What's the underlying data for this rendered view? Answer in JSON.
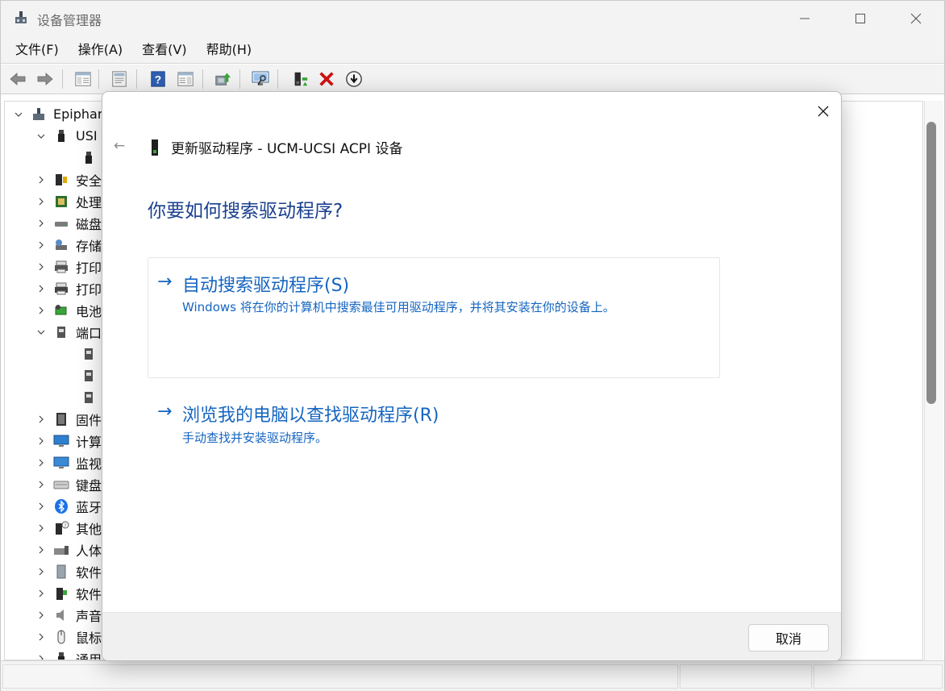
{
  "window": {
    "title": "设备管理器",
    "controls": {
      "minimize": "minimize-icon",
      "maximize": "maximize-icon",
      "close": "close-icon"
    }
  },
  "menu": [
    {
      "label": "文件(F)"
    },
    {
      "label": "操作(A)"
    },
    {
      "label": "查看(V)"
    },
    {
      "label": "帮助(H)"
    }
  ],
  "toolbar": [
    {
      "icon": "back-arrow-icon"
    },
    {
      "icon": "forward-arrow-icon"
    },
    {
      "icon": "show-hide-console-tree-icon"
    },
    {
      "icon": "properties-icon"
    },
    {
      "icon": "help-icon"
    },
    {
      "icon": "action-pane-icon"
    },
    {
      "icon": "update-driver-icon"
    },
    {
      "icon": "scan-hardware-icon"
    },
    {
      "icon": "enable-device-icon"
    },
    {
      "icon": "uninstall-device-icon"
    },
    {
      "icon": "disable-device-icon"
    }
  ],
  "tree": {
    "root": "Epiphar",
    "usb_group": "USI",
    "items": [
      {
        "label": "安全",
        "icon": "security-device-icon"
      },
      {
        "label": "处理",
        "icon": "processor-icon"
      },
      {
        "label": "磁盘",
        "icon": "disk-drive-icon"
      },
      {
        "label": "存储",
        "icon": "storage-controller-icon"
      },
      {
        "label": "打印",
        "icon": "print-queue-icon"
      },
      {
        "label": "打印",
        "icon": "printer-icon"
      },
      {
        "label": "电池",
        "icon": "battery-icon"
      },
      {
        "label": "端口",
        "icon": "port-icon"
      }
    ],
    "items2": [
      {
        "label": "固件",
        "icon": "firmware-icon"
      },
      {
        "label": "计算",
        "icon": "computer-icon"
      },
      {
        "label": "监视",
        "icon": "monitor-icon"
      },
      {
        "label": "键盘",
        "icon": "keyboard-icon"
      },
      {
        "label": "蓝牙",
        "icon": "bluetooth-icon"
      },
      {
        "label": "其他",
        "icon": "other-device-icon"
      },
      {
        "label": "人体",
        "icon": "hid-icon"
      },
      {
        "label": "软件",
        "icon": "software-component-icon"
      },
      {
        "label": "软件",
        "icon": "software-device-icon"
      },
      {
        "label": "声音",
        "icon": "sound-icon"
      },
      {
        "label": "鼠标",
        "icon": "mouse-icon"
      },
      {
        "label": "通用",
        "icon": "usb-controller-icon"
      }
    ]
  },
  "dialog": {
    "header": "更新驱动程序 - UCM-UCSI ACPI 设备",
    "heading": "你要如何搜索驱动程序?",
    "option_auto": {
      "arrow": "→",
      "title": "自动搜索驱动程序(S)",
      "description": "Windows 将在你的计算机中搜索最佳可用驱动程序，并将其安装在你的设备上。"
    },
    "option_browse": {
      "arrow": "→",
      "title": "浏览我的电脑以查找驱动程序(R)",
      "description": "手动查找并安装驱动程序。"
    },
    "cancel_label": "取消",
    "back_arrow": "←"
  },
  "colors": {
    "link_blue": "#1565c0",
    "heading_blue": "#1a3f8f",
    "uninstall_red": "#d01010"
  }
}
